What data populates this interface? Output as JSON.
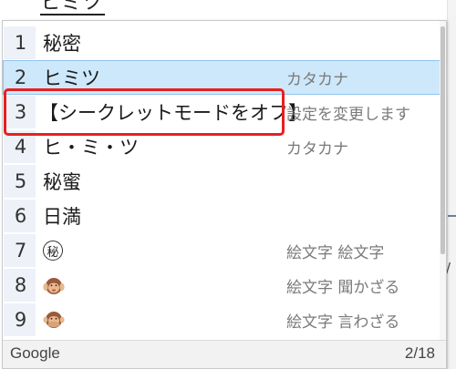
{
  "composition": {
    "text": "ヒミツ"
  },
  "background": {
    "edge_char": "/"
  },
  "candidates": [
    {
      "num": "1",
      "text": "秘密",
      "annotation": ""
    },
    {
      "num": "2",
      "text": "ヒミツ",
      "annotation": "カタカナ"
    },
    {
      "num": "3",
      "text": "【シークレットモードをオフ】",
      "annotation": "設定を変更します"
    },
    {
      "num": "4",
      "text": "ヒ・ミ・ツ",
      "annotation": "カタカナ"
    },
    {
      "num": "5",
      "text": "秘蜜",
      "annotation": ""
    },
    {
      "num": "6",
      "text": "日満",
      "annotation": ""
    },
    {
      "num": "7",
      "text": "秘",
      "annotation": "絵文字 絵文字",
      "icon": "circled-secret-icon"
    },
    {
      "num": "8",
      "text": "",
      "annotation": "絵文字 聞かざる",
      "icon": "hear-no-evil-monkey-icon"
    },
    {
      "num": "9",
      "text": "",
      "annotation": "絵文字 言わざる",
      "icon": "speak-no-evil-monkey-icon"
    }
  ],
  "selected_index": 2,
  "footer": {
    "source": "Google",
    "page": "2/18"
  },
  "colors": {
    "selected_bg": "#cde8fb",
    "highlight_border": "#e81f1f",
    "number_bg": "#eef1f8"
  }
}
